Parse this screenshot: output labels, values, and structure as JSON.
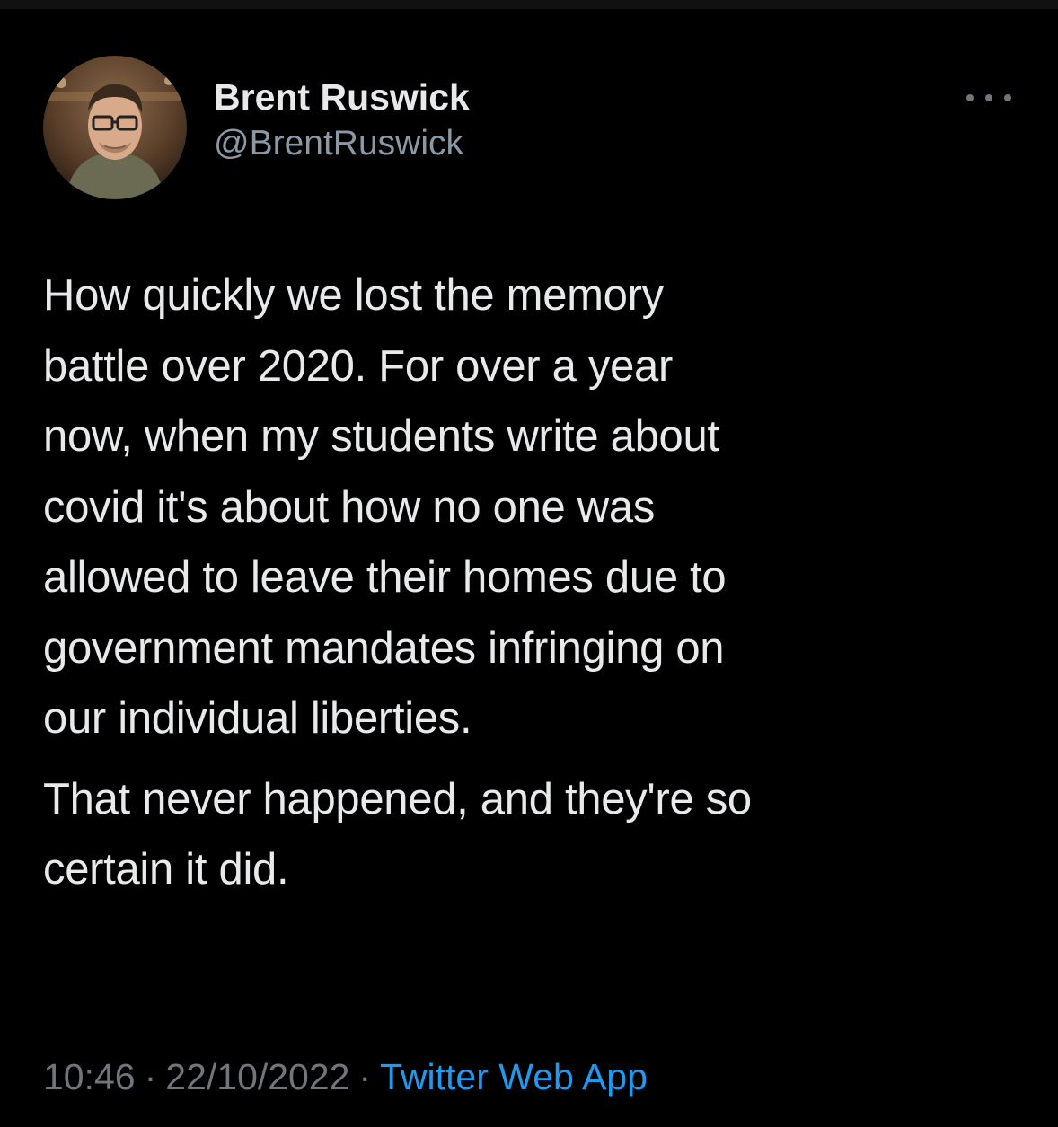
{
  "tweet": {
    "author": {
      "display_name": "Brent Ruswick",
      "handle": "@BrentRuswick",
      "avatar_icon": "profile-photo"
    },
    "more_icon": "more-options-icon",
    "paragraphs": [
      "How quickly we lost the memory\nbattle over 2020. For over a year\nnow, when my students write about\ncovid it's about how no one was\nallowed to leave their homes due to\ngovernment mandates infringing on\nour individual liberties.",
      "That never happened, and they're so\ncertain it did."
    ],
    "meta": {
      "time": "10:46",
      "separator": "·",
      "date": "22/10/2022",
      "source": "Twitter Web App"
    }
  },
  "colors": {
    "background": "#000000",
    "primary_text": "#e7e9ea",
    "secondary_text": "#71767b",
    "link": "#1d9bf0"
  }
}
